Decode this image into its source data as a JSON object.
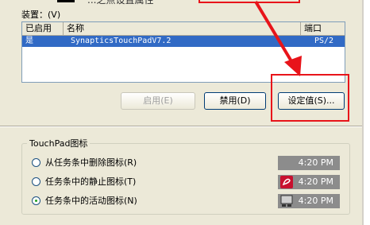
{
  "header": {
    "title_fragment": "...之点设置属性"
  },
  "devices": {
    "label": "装置：(V)",
    "columns": [
      "已启用",
      "名称",
      "端口"
    ],
    "rows": [
      {
        "enabled": "是",
        "name": "SynapticsTouchPadV7.2",
        "port": "PS/2"
      }
    ]
  },
  "buttons": {
    "enable": "启用(E)",
    "disable": "禁用(D)",
    "settings": "设定值(S)..."
  },
  "touchpad_group": {
    "title": "TouchPad图标",
    "options": [
      {
        "label": "从任务条中删除图标(R)",
        "selected": false,
        "time": "4:20 PM",
        "icon": "none"
      },
      {
        "label": "任务条中的静止图标(T)",
        "selected": false,
        "time": "4:20 PM",
        "icon": "synaptics-red-icon"
      },
      {
        "label": "任务条中的活动图标(N)",
        "selected": true,
        "time": "4:20 PM",
        "icon": "touchpad-active-icon"
      }
    ]
  },
  "colors": {
    "accent_red": "#e8141a",
    "selection_blue": "#316ac5"
  }
}
